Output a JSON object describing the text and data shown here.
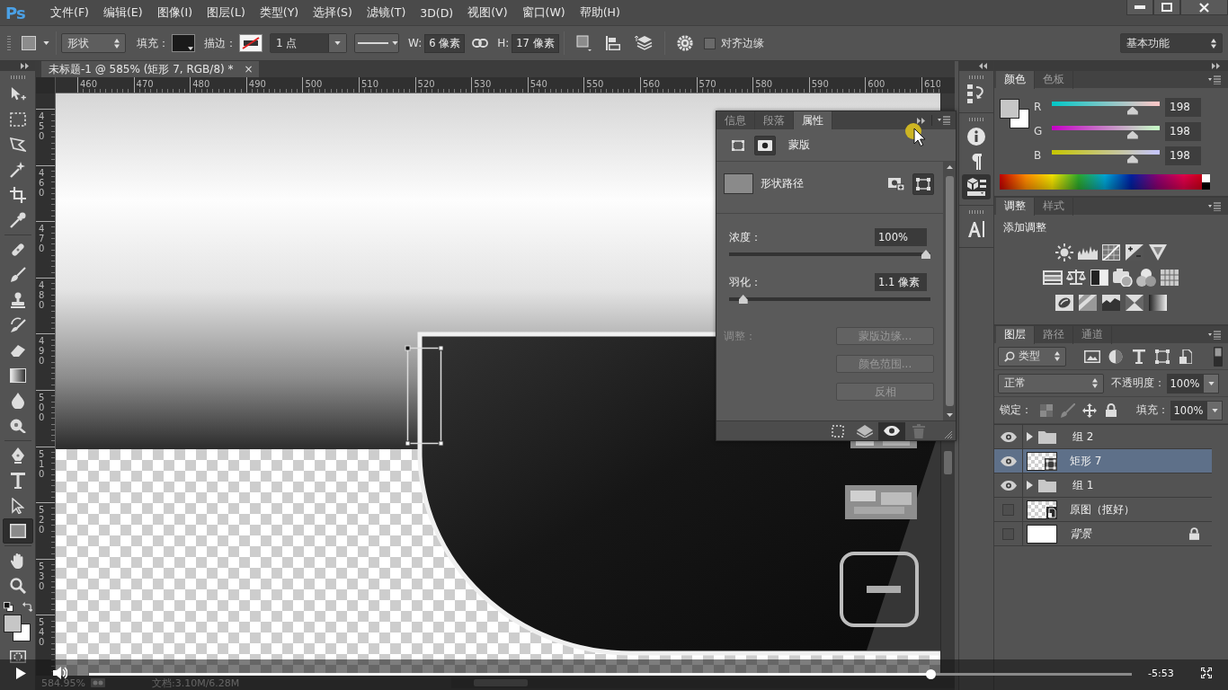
{
  "menu_bar": {
    "logo": "Ps",
    "items": [
      "文件(F)",
      "编辑(E)",
      "图像(I)",
      "图层(L)",
      "类型(Y)",
      "选择(S)",
      "滤镜(T)",
      "3D(D)",
      "视图(V)",
      "窗口(W)",
      "帮助(H)"
    ]
  },
  "options_bar": {
    "mode": "形状",
    "fill_label": "填充：",
    "stroke_label": "描边：",
    "stroke_width": "1 点",
    "w_label": "W:",
    "w_value": "6 像素",
    "h_label": "H:",
    "h_value": "17 像素",
    "align_edges": {
      "label": "对齐边缘",
      "checked": false
    },
    "workspace": "基本功能"
  },
  "document": {
    "tab": "未标题-1 @ 585% (矩形 7, RGB/8) *",
    "close": "×",
    "ruler_h": [
      "460",
      "470",
      "480",
      "490",
      "500",
      "510",
      "520",
      "530",
      "540",
      "550",
      "560",
      "570",
      "580",
      "590",
      "600",
      "610"
    ],
    "ruler_v": [
      "450",
      "460",
      "470",
      "480",
      "490",
      "500",
      "510",
      "520",
      "530",
      "540"
    ]
  },
  "tools": [
    [
      {
        "kind": "move",
        "selected": false
      },
      {
        "kind": "marquee",
        "selected": false
      },
      {
        "kind": "lasso",
        "selected": false
      },
      {
        "kind": "wand",
        "selected": false
      },
      {
        "kind": "crop",
        "selected": false
      },
      {
        "kind": "eyedropper",
        "selected": false
      }
    ],
    [
      {
        "kind": "healing",
        "selected": false
      },
      {
        "kind": "brush",
        "selected": false
      },
      {
        "kind": "stamp",
        "selected": false
      },
      {
        "kind": "history",
        "selected": false
      },
      {
        "kind": "eraser",
        "selected": false
      },
      {
        "kind": "gradient",
        "selected": false
      },
      {
        "kind": "blur",
        "selected": false
      },
      {
        "kind": "dodge",
        "selected": false
      }
    ],
    [
      {
        "kind": "pen",
        "selected": false
      },
      {
        "kind": "type",
        "selected": false
      },
      {
        "kind": "path_select",
        "selected": false
      },
      {
        "kind": "rectangle",
        "selected": true
      }
    ],
    [
      {
        "kind": "hand",
        "selected": false
      },
      {
        "kind": "zoom",
        "selected": false
      }
    ]
  ],
  "properties": {
    "tabs": [
      {
        "label": "信息",
        "selected": false
      },
      {
        "label": "段落",
        "selected": false
      },
      {
        "label": "属性",
        "selected": true
      }
    ],
    "mask_modes": [
      {
        "kind": "pixel",
        "selected": false
      },
      {
        "kind": "vector",
        "selected": true
      }
    ],
    "title": "蒙版",
    "mask_name": "形状路径",
    "mask_actions": [
      {
        "kind": "add_mask",
        "selected": false
      },
      {
        "kind": "select_path",
        "selected": true
      }
    ],
    "sliders": [
      {
        "label": "浓度：",
        "value": "100%",
        "level": 1
      },
      {
        "label": "羽化：",
        "value": "1.1 像素",
        "level": 0.05
      }
    ],
    "refine_label": "调整：",
    "buttons": [
      {
        "label": "蒙版边缘...",
        "disabled": true
      },
      {
        "label": "颜色范围...",
        "disabled": true
      },
      {
        "label": "反相",
        "disabled": true
      }
    ],
    "footer_buttons": [
      {
        "kind": "load_selection",
        "selected": false,
        "disabled": false
      },
      {
        "kind": "apply_mask",
        "selected": false,
        "disabled": false
      },
      {
        "kind": "visibility",
        "selected": true,
        "disabled": false
      },
      {
        "kind": "delete",
        "selected": false,
        "disabled": true
      }
    ]
  },
  "icon_column": [
    [
      {
        "kind": "history",
        "selected": false
      }
    ],
    [
      {
        "kind": "info",
        "selected": false
      },
      {
        "kind": "paragraph",
        "selected": false
      },
      {
        "kind": "properties",
        "selected": true
      }
    ],
    [
      {
        "kind": "character",
        "selected": false
      }
    ]
  ],
  "color_panel": {
    "tabs": [
      {
        "label": "颜色",
        "selected": true
      },
      {
        "label": "色板",
        "selected": false
      }
    ],
    "channels": [
      {
        "name": "R",
        "value": "198",
        "level": 0.776
      },
      {
        "name": "G",
        "value": "198",
        "level": 0.776
      },
      {
        "name": "B",
        "value": "198",
        "level": 0.776
      }
    ]
  },
  "adjustments_panel": {
    "tabs": [
      {
        "label": "调整",
        "selected": true
      },
      {
        "label": "样式",
        "selected": false
      }
    ],
    "title": "添加调整"
  },
  "layers_panel": {
    "tabs": [
      {
        "label": "图层",
        "selected": true
      },
      {
        "label": "路径",
        "selected": false
      },
      {
        "label": "通道",
        "selected": false
      }
    ],
    "filter": "类型",
    "blend_mode": "正常",
    "opacity_label": "不透明度：",
    "opacity": "100%",
    "lock_label": "锁定：",
    "fill_label": "填充：",
    "fill": "100%",
    "layers": [
      {
        "name": "组 2",
        "kind": "group",
        "visible": true,
        "selected": false,
        "expanded": false,
        "locked": false
      },
      {
        "name": "矩形 7",
        "kind": "shape",
        "visible": true,
        "selected": true,
        "expanded": false,
        "locked": false
      },
      {
        "name": "组 1",
        "kind": "group",
        "visible": true,
        "selected": false,
        "expanded": false,
        "locked": false
      },
      {
        "name": "原图（抠好）",
        "kind": "smart",
        "visible": false,
        "selected": false,
        "expanded": false,
        "locked": false
      },
      {
        "name": "背景",
        "kind": "background",
        "visible": false,
        "selected": false,
        "expanded": false,
        "locked": true
      }
    ]
  },
  "status_bar": {
    "zoom": "584.95%",
    "doc_size": "文档:3.10M/6.28M"
  },
  "video_player": {
    "progress": {
      "level": 0.81
    },
    "time": "-5:53"
  }
}
